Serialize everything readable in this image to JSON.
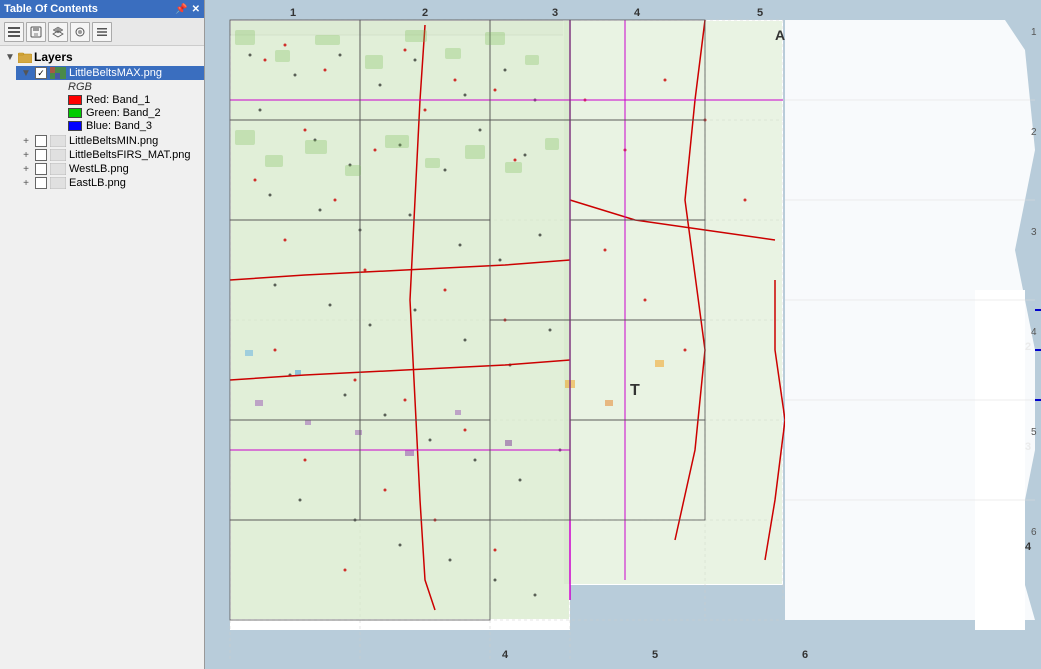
{
  "toc": {
    "title": "Table Of Contents",
    "title_icons": [
      "📌",
      "✕"
    ],
    "toolbar_buttons": [
      {
        "name": "list-view",
        "icon": "☰"
      },
      {
        "name": "save",
        "icon": "💾"
      },
      {
        "name": "layers",
        "icon": "⧉"
      },
      {
        "name": "options",
        "icon": "⚙"
      },
      {
        "name": "more",
        "icon": "⋯"
      }
    ],
    "sections": [
      {
        "name": "Layers",
        "expanded": true,
        "layers": [
          {
            "name": "LittleBeltsMAX.png",
            "visible": true,
            "selected": true,
            "type": "raster",
            "legend": {
              "label": "RGB",
              "bands": [
                {
                  "color": "#FF0000",
                  "label": "Red: Band_1"
                },
                {
                  "color": "#00CC00",
                  "label": "Green: Band_2"
                },
                {
                  "color": "#0000FF",
                  "label": "Blue: Band_3"
                }
              ]
            }
          },
          {
            "name": "LittleBeltsMIN.png",
            "visible": false,
            "selected": false,
            "type": "raster"
          },
          {
            "name": "LittleBeltsFIRS_MAT.png",
            "visible": false,
            "selected": false,
            "type": "raster"
          },
          {
            "name": "WestLB.png",
            "visible": false,
            "selected": false,
            "type": "raster"
          },
          {
            "name": "EastLB.png",
            "visible": false,
            "selected": false,
            "type": "raster"
          }
        ]
      }
    ]
  },
  "map": {
    "grid_numbers_top": [
      "1",
      "2",
      "3",
      "4",
      "5"
    ],
    "grid_numbers_right": [
      "2",
      "3",
      "4",
      "5",
      "6"
    ],
    "grid_numbers_bottom": [
      "4",
      "5",
      "6"
    ]
  }
}
